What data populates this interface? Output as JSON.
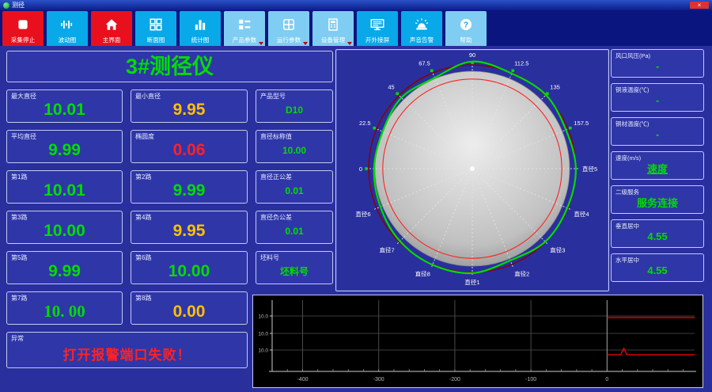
{
  "window": {
    "title": "测径",
    "close_label": "×"
  },
  "colors": {
    "green": "#00dd00",
    "yellow": "#ffc000",
    "red": "#ff2222",
    "toolbar_red": "#e8101d",
    "toolbar_cyan": "#09a8e8",
    "toolbar_light": "#7fcdf2",
    "main_bg": "#2a2f9e",
    "card_bg": "#2f36a8",
    "chart_bg": "#000000"
  },
  "toolbar": {
    "buttons": [
      {
        "name": "btn-stop-acquisition",
        "label": "采集停止",
        "style": "red",
        "icon": "stop-icon"
      },
      {
        "name": "btn-wave-chart",
        "label": "波动图",
        "style": "cyan",
        "icon": "wave-icon"
      },
      {
        "name": "btn-main-screen",
        "label": "主界面",
        "style": "red",
        "icon": "home-icon"
      },
      {
        "name": "btn-section-chart",
        "label": "断面图",
        "style": "cyan",
        "icon": "section-icon"
      },
      {
        "name": "btn-stats-chart",
        "label": "统计图",
        "style": "cyan",
        "icon": "stats-icon"
      },
      {
        "name": "btn-product-params",
        "label": "产品参数",
        "style": "light",
        "icon": "product-params-icon",
        "dropdown": true
      },
      {
        "name": "btn-run-params",
        "label": "运行参数",
        "style": "light",
        "icon": "run-params-icon",
        "dropdown": true
      },
      {
        "name": "btn-device-mgmt",
        "label": "设备管理",
        "style": "light",
        "icon": "device-icon",
        "dropdown": true
      },
      {
        "name": "btn-external-screen",
        "label": "开外接屏",
        "style": "cyan",
        "icon": "monitor-icon"
      },
      {
        "name": "btn-sound-alarm",
        "label": "声音告警",
        "style": "cyan",
        "icon": "alarm-icon"
      },
      {
        "name": "btn-help",
        "label": "帮助",
        "style": "light",
        "icon": "help-icon"
      }
    ]
  },
  "left": {
    "title": "3#测径仪",
    "cells": [
      {
        "name": "max-diameter",
        "label": "最大直径",
        "value": "10.01",
        "color": "green",
        "size": "big"
      },
      {
        "name": "min-diameter",
        "label": "最小直径",
        "value": "9.95",
        "color": "yellow",
        "size": "big"
      },
      {
        "name": "product-model",
        "label": "产品型号",
        "value": "D10",
        "color": "green",
        "size": "small"
      },
      {
        "name": "avg-diameter",
        "label": "平均直径",
        "value": "9.99",
        "color": "green",
        "size": "big"
      },
      {
        "name": "ovality",
        "label": "椭圆度",
        "value": "0.06",
        "color": "red",
        "size": "big"
      },
      {
        "name": "nominal-diameter",
        "label": "直径标称值",
        "value": "10.00",
        "color": "green",
        "size": "small"
      },
      {
        "name": "channel-1",
        "label": "第1路",
        "value": "10.01",
        "color": "green",
        "size": "big"
      },
      {
        "name": "channel-2",
        "label": "第2路",
        "value": "9.99",
        "color": "green",
        "size": "big"
      },
      {
        "name": "tolerance-plus",
        "label": "直径正公差",
        "value": "0.01",
        "color": "green",
        "size": "small"
      },
      {
        "name": "channel-3",
        "label": "第3路",
        "value": "10.00",
        "color": "green",
        "size": "big"
      },
      {
        "name": "channel-4",
        "label": "第4路",
        "value": "9.95",
        "color": "yellow",
        "size": "big"
      },
      {
        "name": "tolerance-minus",
        "label": "直径负公差",
        "value": "0.01",
        "color": "green",
        "size": "small"
      },
      {
        "name": "channel-5",
        "label": "第5路",
        "value": "9.99",
        "color": "green",
        "size": "big"
      },
      {
        "name": "channel-6",
        "label": "第6路",
        "value": "10.00",
        "color": "green",
        "size": "big"
      },
      {
        "name": "billet-no",
        "label": "坯料号",
        "value": "坯料号",
        "color": "green",
        "size": "small"
      },
      {
        "name": "channel-7",
        "label": "第7路",
        "value": "10. 00",
        "color": "green",
        "size": "big",
        "serif": true
      },
      {
        "name": "channel-8",
        "label": "第8路",
        "value": "0.00",
        "color": "yellow",
        "size": "big"
      },
      {
        "name": "exception",
        "label": "异常",
        "value": "打开报警端口失败！",
        "color": "red",
        "size": "alert",
        "span": 2
      }
    ]
  },
  "right_panel": {
    "cards": [
      {
        "name": "air-pressure-card",
        "label": "风口风压(Pa)",
        "value": "-",
        "color": "green"
      },
      {
        "name": "copper-liquid-temp-card",
        "label": "铜液温度(℃)",
        "value": "-",
        "color": "green"
      },
      {
        "name": "copper-material-temp-card",
        "label": "铜材温度(℃)",
        "value": "-",
        "color": "green"
      },
      {
        "name": "speed-card",
        "label": "速度(m/s)",
        "value": "速度",
        "color": "green",
        "underline": true
      },
      {
        "name": "secondary-service-card",
        "label": "二级服务",
        "value": "服务连接",
        "color": "green"
      },
      {
        "name": "vertical-center-card",
        "label": "垂直居中",
        "value": "4.55",
        "color": "green"
      },
      {
        "name": "horizontal-center-card",
        "label": "水平居中",
        "value": "4.55",
        "color": "green"
      }
    ]
  },
  "chart_data": [
    {
      "id": "cross-section-polar",
      "type": "polar-profile",
      "spokes": [
        {
          "angle": 180,
          "label": "0",
          "marker": true
        },
        {
          "angle": 157.5,
          "label": "22.5",
          "marker": true
        },
        {
          "angle": 135,
          "label": "45",
          "marker": true
        },
        {
          "angle": 112.5,
          "label": "67.5",
          "marker": true
        },
        {
          "angle": 90,
          "label": "90",
          "marker": true
        },
        {
          "angle": 67.5,
          "label": "112.5",
          "marker": true
        },
        {
          "angle": 45,
          "label": "135",
          "marker": true
        },
        {
          "angle": 22.5,
          "label": "157.5",
          "marker": true
        },
        {
          "angle": 0,
          "label": "直径5",
          "marker": false
        },
        {
          "angle": 337.5,
          "label": "直径4",
          "marker": false
        },
        {
          "angle": 315,
          "label": "直径3",
          "marker": false
        },
        {
          "angle": 292.5,
          "label": "直径2",
          "marker": false
        },
        {
          "angle": 270,
          "label": "直径1",
          "marker": false
        },
        {
          "angle": 247.5,
          "label": "直径8",
          "marker": false
        },
        {
          "angle": 225,
          "label": "直径7",
          "marker": false
        },
        {
          "angle": 202.5,
          "label": "直径6",
          "marker": false
        }
      ],
      "profile": {
        "name": "measured-profile",
        "color": "#00dd00",
        "angles_deg": [
          0,
          22.5,
          45,
          67.5,
          90,
          112.5,
          135,
          157.5,
          180,
          202.5,
          225,
          247.5,
          270,
          292.5,
          315,
          337.5
        ],
        "radii_ratio": [
          1.064,
          1.042,
          1.07,
          1.058,
          1.1,
          1.01,
          1.03,
          0.996,
          1.01,
          1.022,
          1.052,
          1.068,
          1.072,
          1.02,
          1.06,
          1.056
        ]
      },
      "reference": {
        "body_ratio": 1.0,
        "body_fill": "#b9b9b9",
        "inner_tolerance_ratio": 0.92,
        "inner_color": "#ff2222",
        "outer_tolerance_ratio": 1.064,
        "outer_color": "#8b0000"
      }
    },
    {
      "id": "diameter-trend",
      "type": "line",
      "x_ticks": [
        -400,
        -300,
        -200,
        -100,
        0
      ],
      "x_range": [
        -440,
        115
      ],
      "y_tick_labels": [
        "10.0",
        "10.0",
        "10.0"
      ],
      "series": [
        {
          "name": "upper-trace",
          "color": "#ff0000",
          "x_from": 0,
          "x_to": 115,
          "grid_row": 0
        },
        {
          "name": "lower-trace",
          "color": "#ff0000",
          "x_from": 0,
          "x_to": 115,
          "grid_row": 2,
          "spike_x": 22
        }
      ]
    }
  ]
}
